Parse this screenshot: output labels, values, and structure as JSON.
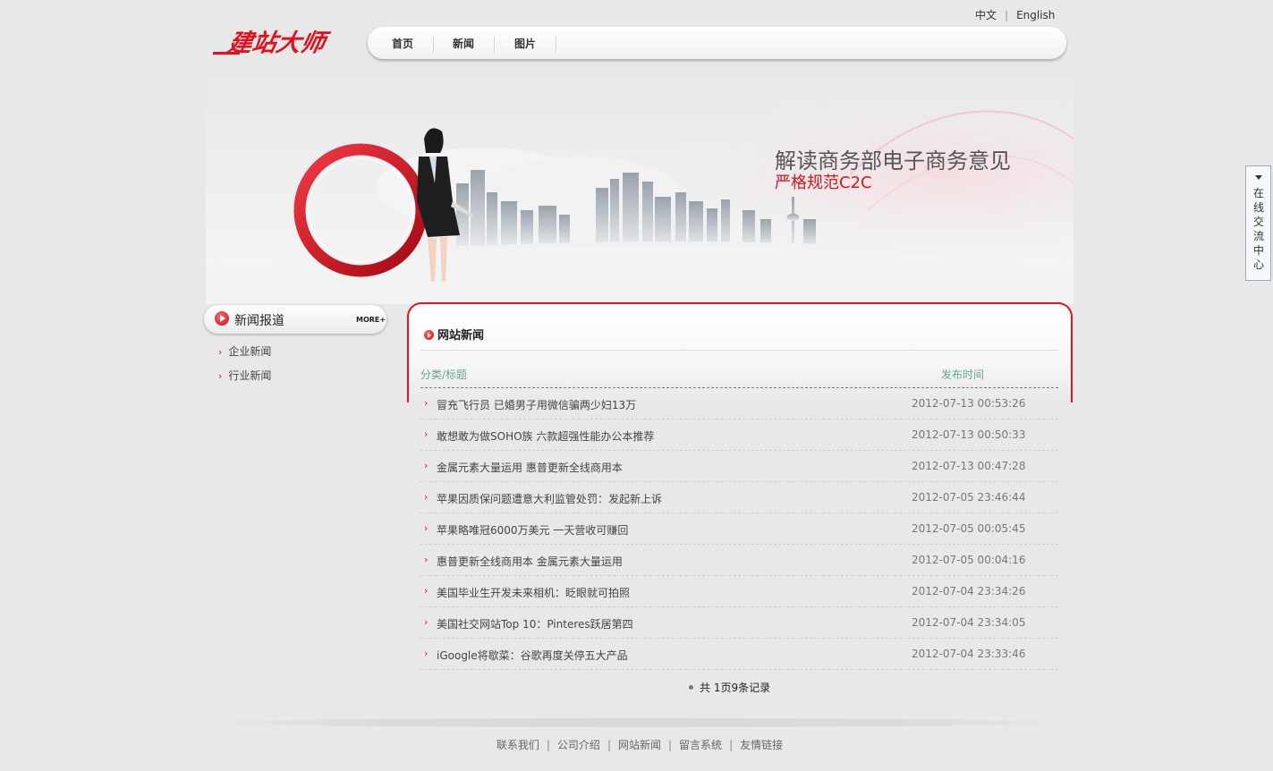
{
  "header": {
    "logo_text": "建站大师",
    "lang": {
      "zh": "中文",
      "separator": "|",
      "en": "English"
    },
    "nav": [
      "首页",
      "新闻",
      "图片"
    ]
  },
  "banner": {
    "headline": "解读商务部电子商务意见",
    "subhead": "严格规范C2C"
  },
  "sidebar": {
    "title": "新闻报道",
    "more": "MORE+",
    "items": [
      "企业新闻",
      "行业新闻"
    ],
    "bullet": "›"
  },
  "main": {
    "title": "网站新闻",
    "col_title": "分类/标题",
    "col_date": "发布时间",
    "bullet": "›",
    "rows": [
      {
        "title": "冒充飞行员 已婚男子用微信骗两少妇13万",
        "date": "2012-07-13 00:53:26"
      },
      {
        "title": "敢想敢为做SOHO族 六款超强性能办公本推荐",
        "date": "2012-07-13 00:50:33"
      },
      {
        "title": "金属元素大量运用 惠普更新全线商用本",
        "date": "2012-07-13 00:47:28"
      },
      {
        "title": "苹果因质保问题遭意大利监管处罚：发起新上诉",
        "date": "2012-07-05 23:46:44"
      },
      {
        "title": "苹果略唯冠6000万美元 一天营收可赚回",
        "date": "2012-07-05 00:05:45"
      },
      {
        "title": "惠普更新全线商用本 金属元素大量运用",
        "date": "2012-07-05 00:04:16"
      },
      {
        "title": "美国毕业生开发未来相机：眨眼就可拍照",
        "date": "2012-07-04 23:34:26"
      },
      {
        "title": "美国社交网站Top 10：Pinteres跃居第四",
        "date": "2012-07-04 23:34:05"
      },
      {
        "title": "iGoogle将歇菜：谷歌再度关停五大产品",
        "date": "2012-07-04 23:33:46"
      }
    ],
    "pager": "共 1页9条记录"
  },
  "footer": {
    "links": [
      "联系我们",
      "公司介绍",
      "网站新闻",
      "留言系统",
      "友情链接"
    ],
    "separator": "|"
  },
  "chat": {
    "label": "在线交流中心"
  },
  "colors": {
    "brand_red": "#d5131e",
    "header_green": "#6aa38f",
    "background": "#e8e8e9"
  }
}
